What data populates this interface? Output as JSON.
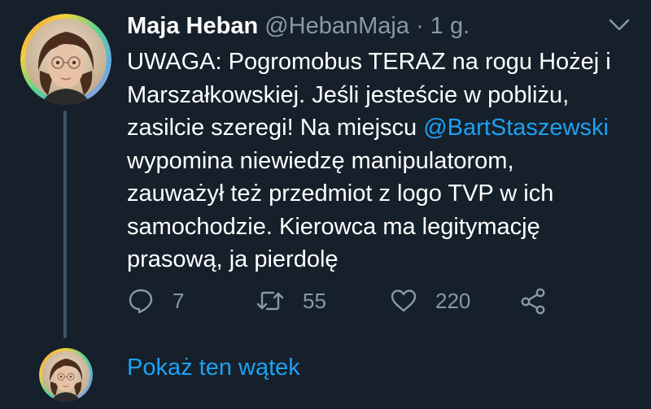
{
  "tweet": {
    "author_name": "Maja Heban",
    "author_handle": "@HebanMaja",
    "separator": "·",
    "time_ago": "1 g.",
    "body": {
      "line1": "UWAGA: Pogromobus TERAZ na rogu Hożej i",
      "line2": "Marszałkowskiej. Jeśli jesteście w pobliżu,",
      "line3_pre": "zasilcie szeregi! Na miejscu ",
      "line3_mention": "@BartStaszewski",
      "line4": "wypomina niewiedzę manipulatorom,",
      "line5": "zauważył też przedmiot z logo TVP w ich",
      "line6": "samochodzie. Kierowca ma legitymację",
      "line7": "prasową, ja pierdolę"
    },
    "actions": {
      "reply_count": "7",
      "retweet_count": "55",
      "like_count": "220"
    },
    "show_thread_label": "Pokaż ten wątek"
  },
  "colors": {
    "background": "#15202b",
    "text_primary": "#ffffff",
    "text_secondary": "#8899a6",
    "accent": "#1da1f2",
    "thread_line": "#3d5466"
  },
  "icons": {
    "reply": "reply-bubble-icon",
    "retweet": "retweet-icon",
    "like": "heart-icon",
    "share": "share-icon",
    "menu": "chevron-down-icon"
  }
}
